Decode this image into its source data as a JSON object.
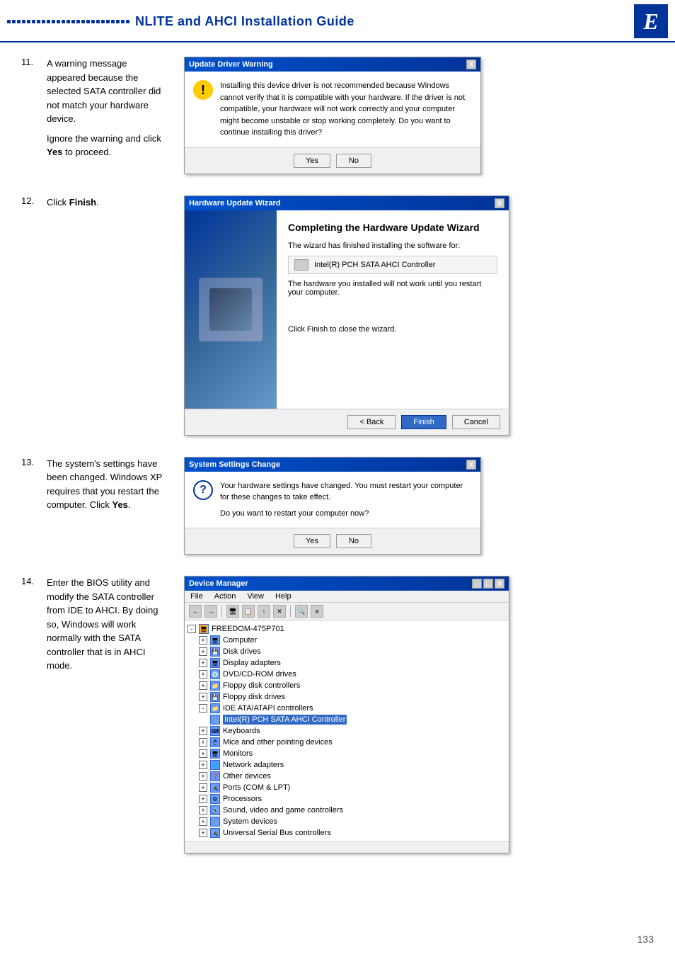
{
  "header": {
    "title": "NLITE and AHCI Installation Guide",
    "logo": "E",
    "dots_count": 25
  },
  "step11": {
    "number": "11.",
    "text_parts": [
      "A warning message appeared because the selected SATA controller did not match your hardware device."
    ],
    "sub_text": "Ignore the warning and click ",
    "sub_bold": "Yes",
    "sub_end": " to proceed.",
    "dialog": {
      "title": "Update Driver Warning",
      "close_btn": "X",
      "body_text": "Installing this device driver is not recommended because Windows cannot verify that it is compatible with your hardware. If the driver is not compatible, your hardware will not work correctly and your computer might become unstable or stop working completely. Do you want to continue installing this driver?",
      "btn_yes": "Yes",
      "btn_no": "No"
    }
  },
  "step12": {
    "number": "12.",
    "text": "Click ",
    "bold": "Finish",
    "text_end": ".",
    "dialog": {
      "title": "Hardware Update Wizard",
      "close_btn": "X",
      "wizard_title": "Completing the Hardware Update Wizard",
      "text1": "The wizard has finished installing the software for:",
      "device_name": "Intel(R) PCH SATA AHCI Controller",
      "text2": "The hardware you installed will not work until you restart your computer.",
      "footer_text": "Click Finish to close the wizard.",
      "btn_back": "< Back",
      "btn_finish": "Finish",
      "btn_cancel": "Cancel"
    }
  },
  "step13": {
    "number": "13.",
    "text": "The system's settings have been changed. Windows XP requires that you restart the computer. Click ",
    "bold": "Yes",
    "text_end": ".",
    "dialog": {
      "title": "System Settings Change",
      "close_btn": "X",
      "body_text": "Your hardware settings have changed. You must restart your computer for these changes to take effect.",
      "sub_text": "Do you want to restart your computer now?",
      "btn_yes": "Yes",
      "btn_no": "No"
    }
  },
  "step14": {
    "number": "14.",
    "text": "Enter the BIOS utility and modify the SATA controller from IDE to AHCI. By doing so, Windows will work normally with the SATA controller that is in AHCI mode.",
    "dialog": {
      "title": "Device Manager",
      "menu_items": [
        "File",
        "Action",
        "View",
        "Help"
      ],
      "tree_root": "FREEDOM-475P701",
      "tree_items": [
        "Computer",
        "Disk drives",
        "Display adapters",
        "DVD/CD-ROM drives",
        "Floppy disk controllers",
        "Floppy disk drives",
        "IDE ATA/ATAPI controllers",
        "Intel(R) PCH SATA AHCI Controller",
        "Keyboards",
        "Mice and other pointing devices",
        "Monitors",
        "Network adapters",
        "Other devices",
        "Ports (COM & LPT)",
        "Processors",
        "Sound, video and game controllers",
        "System devices",
        "Universal Serial Bus controllers"
      ],
      "highlighted_item": "Intel(R) PCH SATA AHCI Controller"
    }
  },
  "page_number": "133"
}
